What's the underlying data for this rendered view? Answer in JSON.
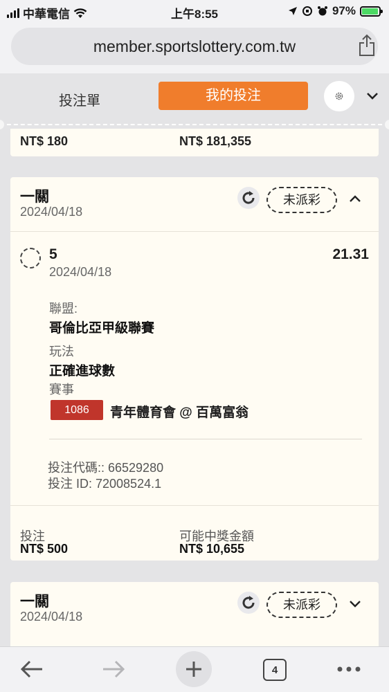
{
  "status_bar": {
    "carrier": "中華電信",
    "time": "上午8:55",
    "battery": "97%",
    "battery_level": 0.97
  },
  "browser": {
    "url": "member.sportslottery.com.tw",
    "share_icon": "share-icon"
  },
  "tabs": {
    "betslip": "投注單",
    "my_bets": "我的投注",
    "settings_icon": "gear-icon"
  },
  "previous_card": {
    "stake": "NT$ 180",
    "payout": "NT$ 181,355"
  },
  "bet_card": {
    "type": "一關",
    "date": "2024/04/18",
    "status": "未派彩",
    "selection": {
      "name": "5",
      "date": "2024/04/18",
      "odds": "21.31",
      "league_label": "聯盟:",
      "league": "哥倫比亞甲級聯賽",
      "market_label": "玩法",
      "market": "正確進球數",
      "event_label": "賽事",
      "event_number": "1086",
      "event_name": "青年體育會 @ 百萬富翁"
    },
    "bet_code": "投注代碼:: 66529280",
    "bet_id": "投注 ID: 72008524.1",
    "stake_label": "投注",
    "stake": "NT$ 500",
    "payout_label": "可能中獎金額",
    "payout": "NT$ 10,655"
  },
  "next_card": {
    "type": "一關",
    "date": "2024/04/18",
    "status": "未派彩"
  },
  "toolbar": {
    "tabs_count": "4"
  }
}
